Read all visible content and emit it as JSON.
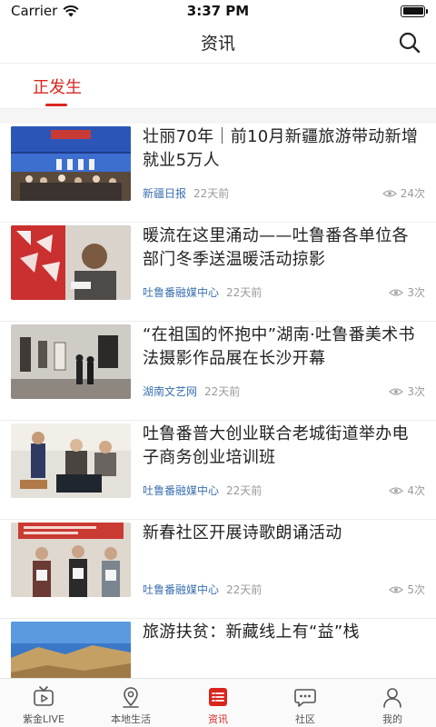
{
  "status_bar": {
    "carrier": "Carrier",
    "time": "3:37 PM"
  },
  "header": {
    "title": "资讯"
  },
  "category_tab": {
    "label": "正发生"
  },
  "news": [
    {
      "title": "壮丽70年｜前10月新疆旅游带动新增就业5万人",
      "source": "新疆日报",
      "time": "22天前",
      "views": "24次"
    },
    {
      "title": "暖流在这里涌动——吐鲁番各单位各部门冬季送温暖活动掠影",
      "source": "吐鲁番融媒中心",
      "time": "22天前",
      "views": "3次"
    },
    {
      "title": "“在祖国的怀抱中”湖南·吐鲁番美术书法摄影作品展在长沙开幕",
      "source": "湖南文艺网",
      "time": "22天前",
      "views": "3次"
    },
    {
      "title": "吐鲁番普大创业联合老城街道举办电子商务创业培训班",
      "source": "吐鲁番融媒中心",
      "time": "22天前",
      "views": "4次"
    },
    {
      "title": "新春社区开展诗歌朗诵活动",
      "source": "吐鲁番融媒中心",
      "time": "22天前",
      "views": "5次"
    },
    {
      "title": "旅游扶贫：新藏线上有“益”栈",
      "source": "",
      "time": "",
      "views": ""
    }
  ],
  "bottom_tabs": [
    {
      "label": "紫金LIVE",
      "icon": "tv-icon"
    },
    {
      "label": "本地生活",
      "icon": "location-pin-icon"
    },
    {
      "label": "资讯",
      "icon": "news-list-icon"
    },
    {
      "label": "社区",
      "icon": "chat-bubble-icon"
    },
    {
      "label": "我的",
      "icon": "user-icon"
    }
  ],
  "colors": {
    "accent": "#d8261f",
    "source_blue": "#3a6fb0",
    "meta_gray": "#9a9a9a"
  }
}
